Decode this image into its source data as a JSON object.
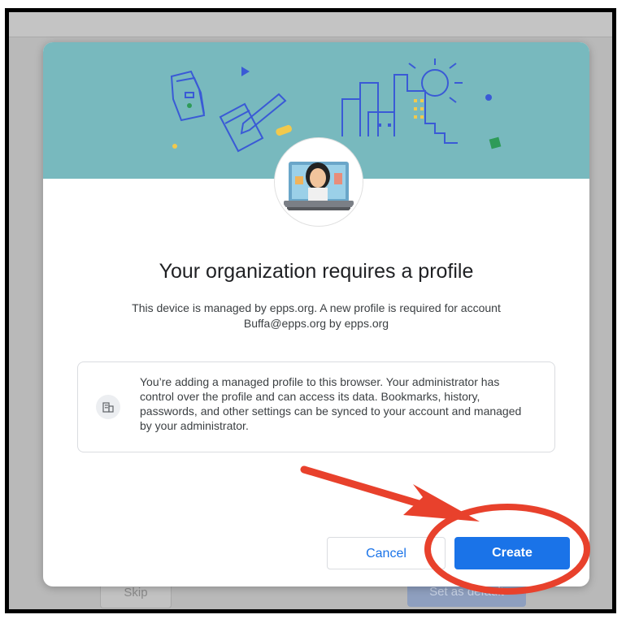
{
  "background": {
    "skip_label": "Skip",
    "set_default_label": "Set as default"
  },
  "dialog": {
    "title": "Your organization requires a profile",
    "subtitle_line1": "This device is managed by epps.org. A new profile is required for account",
    "subtitle_line2": "Buffa@epps.org by epps.org",
    "info_text": "You’re adding a managed profile to this browser. Your administrator has control over the profile and can access its data. Bookmarks, history, passwords, and other settings can be synced to your account and managed by your administrator.",
    "info_icon": "building-icon",
    "avatar_icon": "user-avatar",
    "banner_color": "#78b9be"
  },
  "buttons": {
    "cancel_label": "Cancel",
    "create_label": "Create"
  },
  "colors": {
    "accent": "#1a73e8",
    "annotation": "#e8412c"
  },
  "annotations": {
    "arrow_icon": "red-arrow",
    "circle_icon": "red-circle-highlight"
  }
}
